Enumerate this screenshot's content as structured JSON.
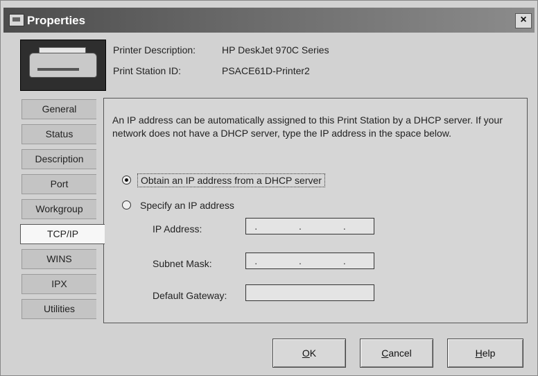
{
  "window": {
    "title": "Properties",
    "close_label": "×"
  },
  "header": {
    "printer_description_label": "Printer Description:",
    "printer_description_value": "HP DeskJet 970C Series",
    "print_station_label": "Print Station ID:",
    "print_station_value": "PSACE61D-Printer2"
  },
  "tabs": [
    {
      "label": "General"
    },
    {
      "label": "Status"
    },
    {
      "label": "Description"
    },
    {
      "label": "Port"
    },
    {
      "label": "Workgroup"
    },
    {
      "label": "TCP/IP",
      "active": true
    },
    {
      "label": "WINS"
    },
    {
      "label": "IPX"
    },
    {
      "label": "Utilities"
    }
  ],
  "tcpip": {
    "description": "An IP address can be automatically assigned to this Print Station by a DHCP server. If your network does not have a DHCP server, type the IP address in the space below.",
    "option_dhcp": "Obtain an IP address from a DHCP server",
    "option_specify": "Specify an IP address",
    "selected_option": "dhcp",
    "ip_address_label": "IP Address:",
    "subnet_mask_label": "Subnet Mask:",
    "default_gateway_label": "Default Gateway:",
    "ip_address_value": ". . .",
    "subnet_mask_value": ". . .",
    "default_gateway_value": ""
  },
  "buttons": {
    "ok_mnemonic": "O",
    "ok_rest": "K",
    "cancel_mnemonic": "C",
    "cancel_rest": "ancel",
    "help_mnemonic": "H",
    "help_rest": "elp"
  }
}
